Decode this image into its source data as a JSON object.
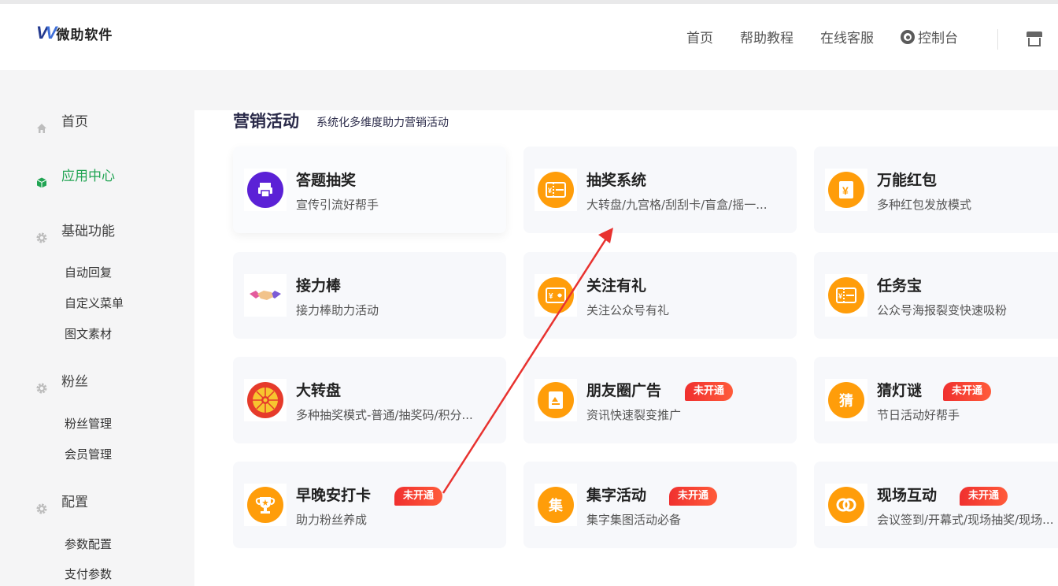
{
  "header": {
    "logo_text": "微助软件",
    "nav": [
      "首页",
      "帮助教程",
      "在线客服"
    ],
    "console": "控制台"
  },
  "sidebar": {
    "home": "首页",
    "app_center": "应用中心",
    "basic": "基础功能",
    "basic_items": [
      "自动回复",
      "自定义菜单",
      "图文素材"
    ],
    "fans": "粉丝",
    "fans_items": [
      "粉丝管理",
      "会员管理"
    ],
    "config": "配置",
    "config_items": [
      "参数配置",
      "支付参数"
    ]
  },
  "section": {
    "title": "营销活动",
    "subtitle": "系统化多维度助力营销活动"
  },
  "badge_text": "未开通",
  "cards": [
    {
      "name": "答题抽奖",
      "desc": "宣传引流好帮手",
      "icon": "printer-icon",
      "color": "#5b21d6"
    },
    {
      "name": "抽奖系统",
      "desc": "大转盘/九宫格/刮刮卡/盲盒/摇一...",
      "icon": "ticket-icon",
      "color": "#ff9d0a"
    },
    {
      "name": "万能红包",
      "desc": "多种红包发放模式",
      "icon": "red-packet-icon",
      "color": "#ff9d0a"
    },
    {
      "name": "接力棒",
      "desc": "接力棒助力活动",
      "icon": "handshake-icon",
      "color": "#ffffff"
    },
    {
      "name": "关注有礼",
      "desc": "关注公众号有礼",
      "icon": "gift-card-icon",
      "color": "#ff9d0a"
    },
    {
      "name": "任务宝",
      "desc": "公众号海报裂变快速吸粉",
      "icon": "ticket-icon",
      "color": "#ff9d0a"
    },
    {
      "name": "大转盘",
      "desc": "多种抽奖模式-普通/抽奖码/积分...",
      "icon": "wheel-icon",
      "color": "#e63b2b"
    },
    {
      "name": "朋友圈广告",
      "desc": "资讯快速裂变推广",
      "icon": "poster-icon",
      "color": "#ff9d0a"
    },
    {
      "name": "猜灯谜",
      "desc": "节日活动好帮手",
      "icon": "riddle-icon",
      "color": "#ff9d0a",
      "glyph": "猜"
    },
    {
      "name": "早晚安打卡",
      "desc": "助力粉丝养成",
      "icon": "trophy-icon",
      "color": "#ff9d0a"
    },
    {
      "name": "集字活动",
      "desc": "集字集图活动必备",
      "icon": "collect-icon",
      "color": "#ff9d0a",
      "glyph": "集"
    },
    {
      "name": "现场互动",
      "desc": "会议签到/开幕式/现场抽奖/现场...",
      "icon": "link-icon",
      "color": "#ff9d0a"
    }
  ]
}
